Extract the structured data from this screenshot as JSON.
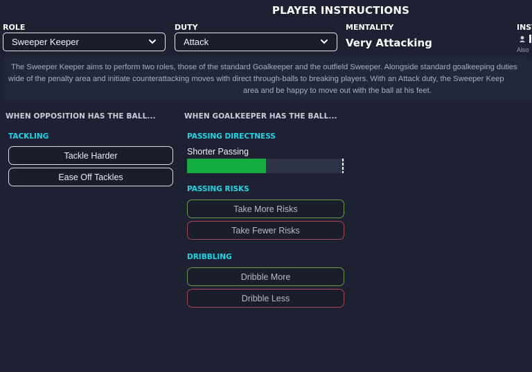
{
  "header": {
    "title": "PLAYER INSTRUCTIONS",
    "role_label": "ROLE",
    "role_value": "Sweeper Keeper",
    "duty_label": "DUTY",
    "duty_value": "Attack",
    "mentality_label": "MENTALITY",
    "mentality_value": "Very Attacking",
    "inst_label": "INST",
    "inst_sub": "Also"
  },
  "description": {
    "line1": "The Sweeper Keeper aims to perform two roles, those of the standard Goalkeeper and the outfield Sweeper. Alongside standard goalkeeping duties",
    "line2": "wide of the penalty area and initiate counterattacking moves with direct through-balls to breaking players. With an Attack duty, the Sweeper Keep",
    "line3": "area and be happy to move out with the ball at his feet."
  },
  "opposition": {
    "heading": "WHEN OPPOSITION HAS THE BALL...",
    "tackling_label": "TACKLING",
    "tackle_harder": "Tackle Harder",
    "ease_off": "Ease Off Tackles"
  },
  "goalkeeper": {
    "heading": "WHEN GOALKEEPER HAS THE BALL...",
    "passing_directness_label": "PASSING DIRECTNESS",
    "passing_value": "Shorter Passing",
    "passing_level": 0.5,
    "passing_risks_label": "PASSING RISKS",
    "take_more_risks": "Take More Risks",
    "take_fewer_risks": "Take Fewer Risks",
    "dribbling_label": "DRIBBLING",
    "dribble_more": "Dribble More",
    "dribble_less": "Dribble Less"
  },
  "colors": {
    "background": "#1d2131",
    "accent_cyan": "#19d7e6",
    "slider_fill": "#13ad3f",
    "green_border": "#6f9a45",
    "red_border": "#a8474f"
  },
  "icons": {
    "dropdown": "chevron-down-icon",
    "instructions": "person-icon"
  }
}
